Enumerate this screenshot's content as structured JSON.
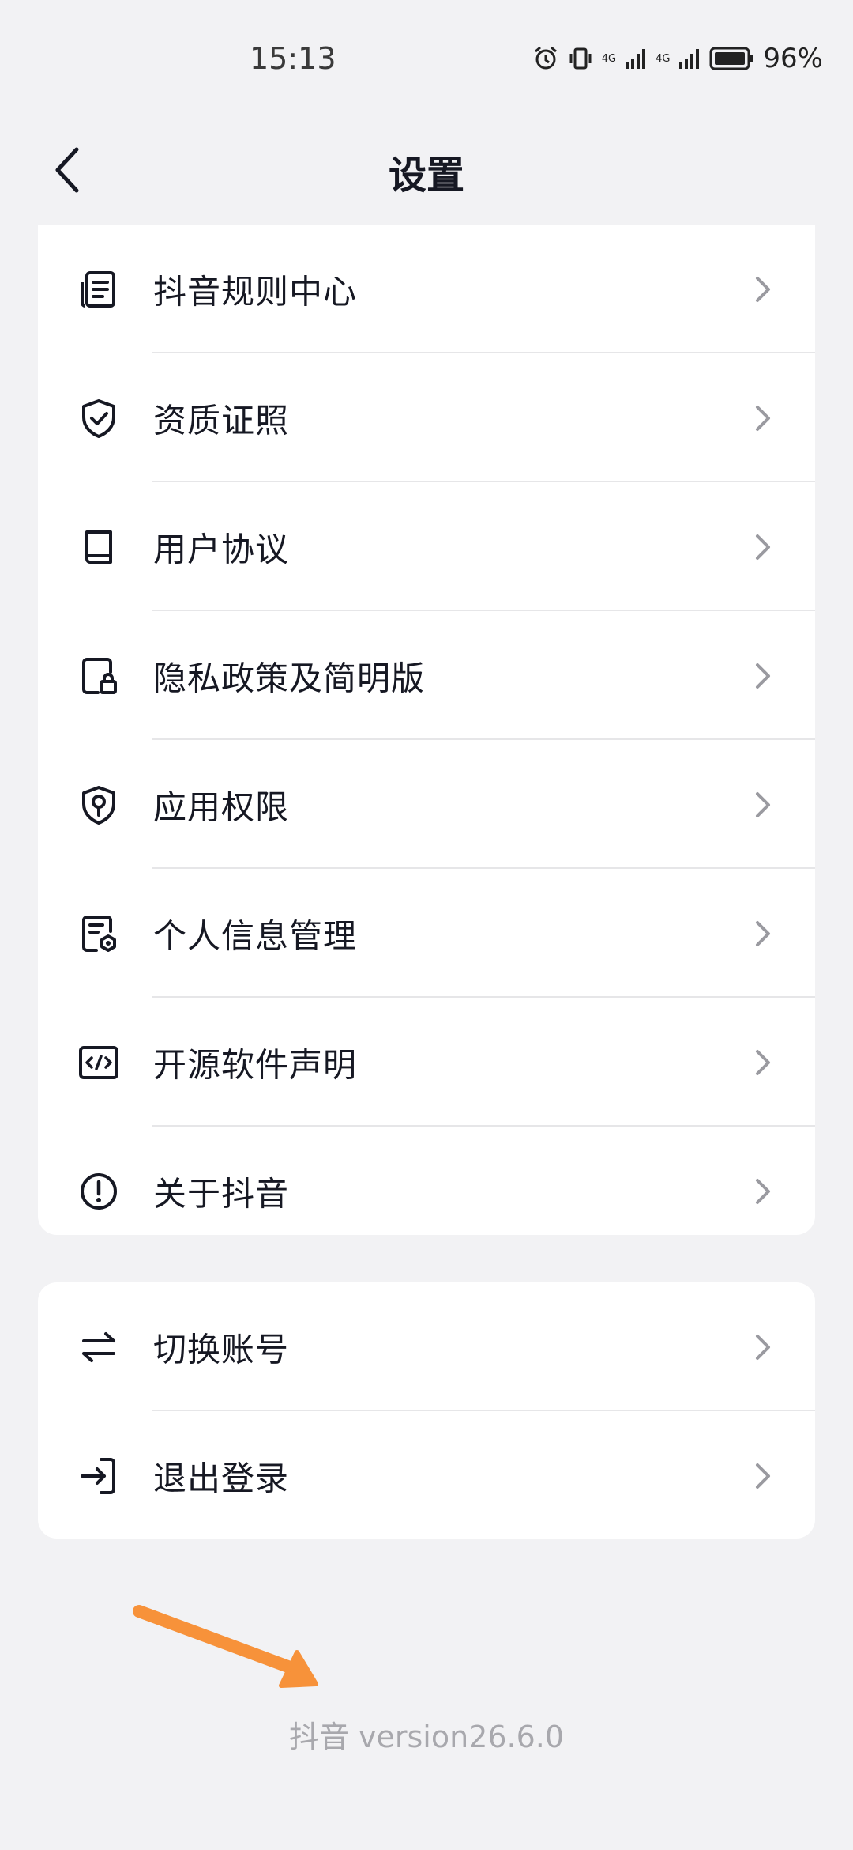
{
  "status_bar": {
    "time": "15:13",
    "battery": "96%",
    "network_1": "4G",
    "network_2": "4G"
  },
  "header": {
    "title": "设置"
  },
  "menu_main": [
    {
      "label": "抖音规则中心",
      "icon": "document-list-icon"
    },
    {
      "label": "资质证照",
      "icon": "shield-check-icon"
    },
    {
      "label": "用户协议",
      "icon": "book-icon"
    },
    {
      "label": "隐私政策及简明版",
      "icon": "file-lock-icon"
    },
    {
      "label": "应用权限",
      "icon": "shield-key-icon"
    },
    {
      "label": "个人信息管理",
      "icon": "file-gear-icon"
    },
    {
      "label": "开源软件声明",
      "icon": "code-icon"
    },
    {
      "label": "关于抖音",
      "icon": "info-circle-icon"
    }
  ],
  "menu_account": [
    {
      "label": "切换账号",
      "icon": "swap-icon"
    },
    {
      "label": "退出登录",
      "icon": "logout-icon"
    }
  ],
  "footer": {
    "version_text": "抖音 version26.6.0"
  },
  "colors": {
    "background": "#f2f2f4",
    "card": "#ffffff",
    "text": "#161823",
    "annotation_arrow": "#f7923a"
  }
}
